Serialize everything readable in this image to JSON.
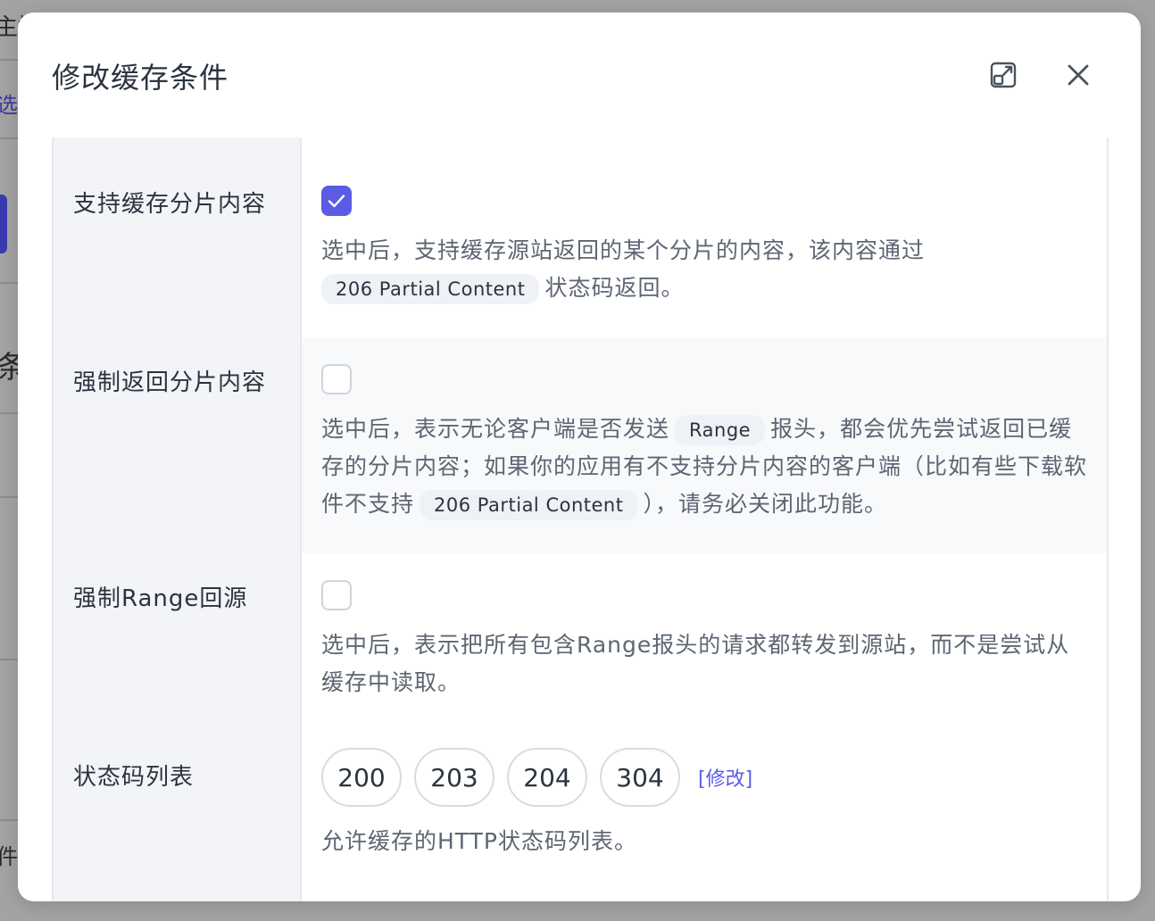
{
  "modal": {
    "title": "修改缓存条件"
  },
  "rows": [
    {
      "label": "支持缓存分片内容",
      "checked": true,
      "desc_before": "选中后，支持缓存源站返回的某个分片的内容，该内容通过",
      "code1": "206 Partial Content",
      "desc_after": "状态码返回。"
    },
    {
      "label": "强制返回分片内容",
      "checked": false,
      "desc_part1": "选中后，表示无论客户端是否发送",
      "code1": "Range",
      "desc_part2": "报头，都会优先尝试返回已缓存的分片内容；如果你的应用有不支持分片内容的客户端（比如有些下载软件不支持",
      "code2": "206 Partial Content",
      "desc_part3": "），请务必关闭此功能。"
    },
    {
      "label": "强制Range回源",
      "checked": false,
      "desc": "选中后，表示把所有包含Range报头的请求都转发到源站，而不是尝试从缓存中读取。"
    },
    {
      "label": "状态码列表",
      "codes": [
        "200",
        "203",
        "204",
        "304"
      ],
      "edit_label": "[修改]",
      "desc": "允许缓存的HTTP状态码列表。"
    }
  ],
  "colors": {
    "accent": "#5b5ce6",
    "label_bg": "#f2f4f7",
    "text": "#2b3340",
    "muted": "#5d6673"
  }
}
